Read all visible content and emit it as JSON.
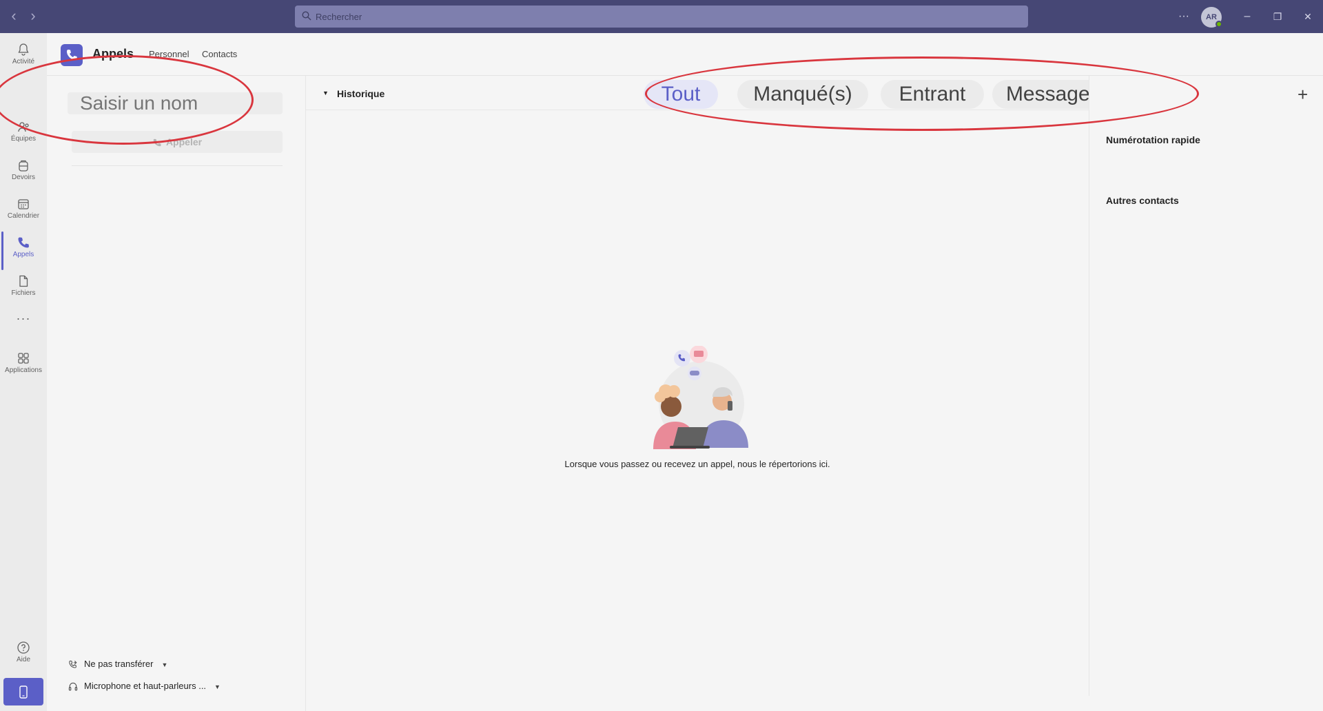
{
  "titlebar": {
    "back_glyph": "‹",
    "forward_glyph": "›",
    "search_placeholder": "Rechercher",
    "more_glyph": "···",
    "avatar_initials": "AR",
    "minimize_glyph": "–",
    "restore_glyph": "❐",
    "close_glyph": "✕"
  },
  "rail": {
    "items": [
      {
        "label": "Activité",
        "icon": "bell-icon"
      },
      {
        "label": "Équipes",
        "icon": "teams-icon"
      },
      {
        "label": "Devoirs",
        "icon": "backpack-icon"
      },
      {
        "label": "Calendrier",
        "icon": "calendar-icon"
      },
      {
        "label": "Appels",
        "icon": "phone-icon"
      },
      {
        "label": "Fichiers",
        "icon": "file-icon"
      },
      {
        "label": "Applications",
        "icon": "apps-icon"
      },
      {
        "label": "Aide",
        "icon": "help-icon"
      }
    ],
    "more_glyph": "···",
    "active": "Appels"
  },
  "app": {
    "title": "Appels",
    "tabs": [
      "Personnel",
      "Contacts"
    ]
  },
  "left_panel": {
    "name_input_placeholder": "Saisir un nom",
    "call_button": "Appeler",
    "forwarding_label": "Ne pas transférer",
    "device_label": "Microphone et haut-parleurs ..."
  },
  "center": {
    "history_label": "Historique",
    "filters": [
      "Tout",
      "Manqué(s)",
      "Entrant",
      "Messagerie vocale"
    ],
    "selected_filter": "Tout",
    "empty_message": "Lorsque vous passez ou recevez un appel, nous le répertorions ici."
  },
  "right_panel": {
    "add_glyph": "+",
    "speed_dial": "Numérotation rapide",
    "other_contacts": "Autres contacts"
  },
  "colors": {
    "titlebar": "#464775",
    "accent": "#5b5fc7",
    "annotation": "#d9363e"
  }
}
